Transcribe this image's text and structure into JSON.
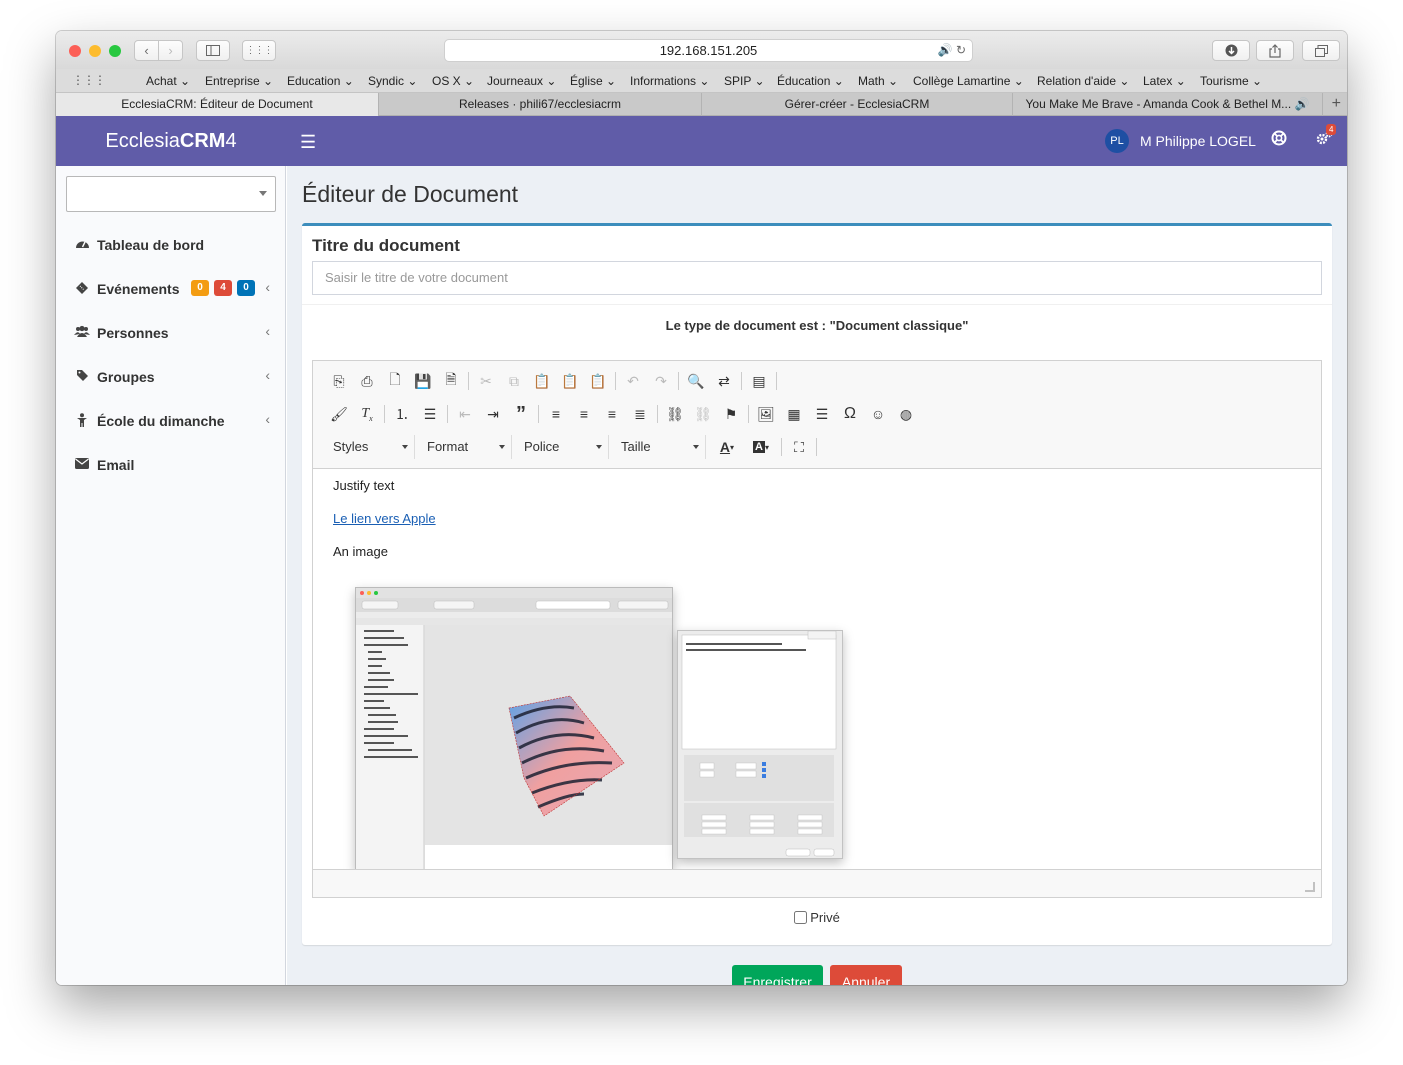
{
  "browser": {
    "url": "192.168.151.205",
    "bookmarks": [
      "Achat",
      "Entreprise",
      "Education",
      "Syndic",
      "OS X",
      "Journeaux",
      "Église",
      "Informations",
      "SPIP",
      "Éducation",
      "Math",
      "Collège Lamartine",
      "Relation d'aide",
      "Latex",
      "Tourisme"
    ],
    "tabs": [
      "EcclesiaCRM: Éditeur de Document",
      "Releases · phili67/ecclesiacrm",
      "Gérer-créer - EcclesiaCRM",
      "You Make Me Brave - Amanda Cook & Bethel M..."
    ]
  },
  "header": {
    "logo_light": "Ecclesia",
    "logo_bold": "CRM",
    "logo_version": "4",
    "avatar_initials": "PL",
    "user_name": "M Philippe LOGEL",
    "settings_badge": "4"
  },
  "sidebar": {
    "items": [
      {
        "label": "Tableau de bord",
        "icon": "dashboard-icon"
      },
      {
        "label": "Evénements",
        "icon": "ticket-icon",
        "badges": [
          "0",
          "4",
          "0"
        ]
      },
      {
        "label": "Personnes",
        "icon": "users-icon"
      },
      {
        "label": "Groupes",
        "icon": "tag-icon"
      },
      {
        "label": "École du dimanche",
        "icon": "child-icon"
      },
      {
        "label": "Email",
        "icon": "envelope-icon"
      }
    ]
  },
  "main": {
    "page_title": "Éditeur de Document",
    "doc_title_label": "Titre du document",
    "doc_title_placeholder": "Saisir le titre de votre document",
    "doc_type_text": "Le type de document est : \"Document classique\"",
    "editor": {
      "combos": [
        "Styles",
        "Format",
        "Police",
        "Taille"
      ],
      "content": {
        "p1": "Justify text",
        "link": "Le lien vers Apple",
        "p2": "An image"
      }
    },
    "private_label": "Privé",
    "save_label": "Enregistrer",
    "cancel_label": "Annuler"
  },
  "colors": {
    "header_bg": "#605ca8",
    "box_accent": "#3c8dbc",
    "save_btn": "#00a65a",
    "cancel_btn": "#dd4b39",
    "badge_orange": "#f39c12",
    "badge_red": "#dd4b39",
    "badge_blue": "#0073b7"
  }
}
